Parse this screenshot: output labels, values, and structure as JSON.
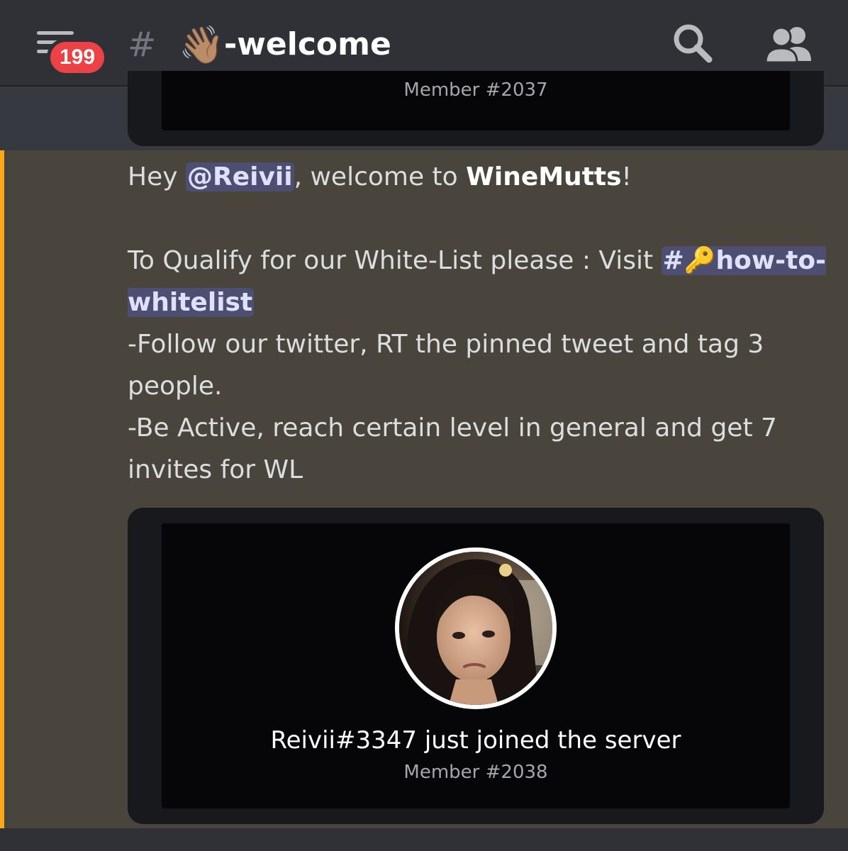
{
  "header": {
    "unread_count": "199",
    "channel_hash": "#",
    "channel_emoji": "👋🏽",
    "channel_name": "-welcome"
  },
  "previous_embed": {
    "member_count": "Member #2037"
  },
  "message": {
    "greeting_prefix": "Hey ",
    "mention": "@Reivii",
    "greeting_middle": ", welcome to ",
    "server_name": "WineMutts",
    "greeting_suffix": "!",
    "qualify_text": "To Qualify for our White-List please : Visit ",
    "channel_link": "#🔑how-to-whitelist",
    "rule_1": "-Follow our twitter, RT the pinned tweet and tag 3 people.",
    "rule_2": "-Be Active, reach certain level in general and get 7 invites for WL"
  },
  "welcome_card": {
    "joined_text": "Reivii#3347 just joined the server",
    "member_count": "Member #2038"
  },
  "colors": {
    "mention_highlight": "#faa81a",
    "badge": "#ed4245",
    "link": "#5865f2"
  }
}
